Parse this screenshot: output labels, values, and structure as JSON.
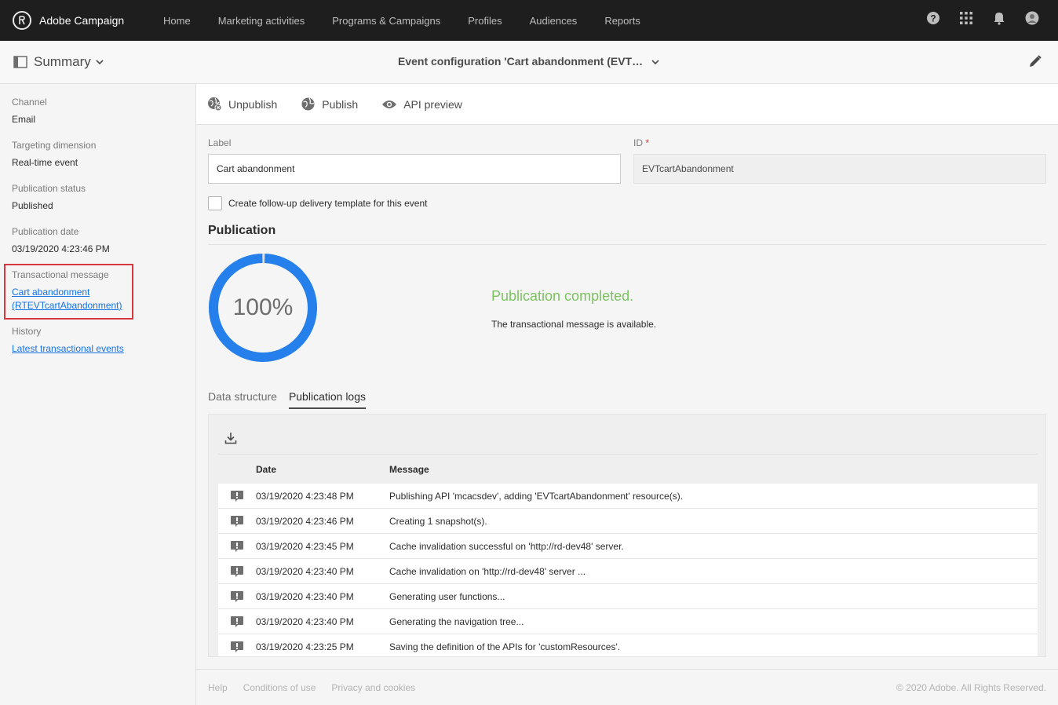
{
  "app": {
    "name": "Adobe Campaign",
    "nav": [
      "Home",
      "Marketing activities",
      "Programs & Campaigns",
      "Profiles",
      "Audiences",
      "Reports"
    ]
  },
  "header": {
    "summary_label": "Summary",
    "title": "Event configuration 'Cart abandonment (EVT…"
  },
  "sidebar": {
    "channel_label": "Channel",
    "channel_value": "Email",
    "targeting_label": "Targeting dimension",
    "targeting_value": "Real-time event",
    "status_label": "Publication status",
    "status_value": "Published",
    "date_label": "Publication date",
    "date_value": "03/19/2020 4:23:46 PM",
    "tm_label": "Transactional message",
    "tm_link_line1": "Cart abandonment",
    "tm_link_line2": "(RTEVTcartAbandonment)",
    "history_label": "History",
    "history_link": "Latest transactional events"
  },
  "toolbar": {
    "unpublish": "Unpublish",
    "publish": "Publish",
    "api_preview": "API preview"
  },
  "form": {
    "label_title": "Label",
    "label_value": "Cart abandonment",
    "id_title": "ID",
    "id_required": "*",
    "id_value": "EVTcartAbandonment",
    "checkbox_label": "Create follow-up delivery template for this event"
  },
  "publication": {
    "title": "Publication",
    "progress_text": "100%",
    "progress_value": 100,
    "status": "Publication completed.",
    "description": "The transactional message is available."
  },
  "tabs": [
    "Data structure",
    "Publication logs"
  ],
  "active_tab": "Publication logs",
  "logs": {
    "col_date": "Date",
    "col_message": "Message",
    "rows": [
      {
        "date": "03/19/2020 4:23:48 PM",
        "message": "Publishing API 'mcacsdev', adding 'EVTcartAbandonment' resource(s)."
      },
      {
        "date": "03/19/2020 4:23:46 PM",
        "message": "Creating 1 snapshot(s)."
      },
      {
        "date": "03/19/2020 4:23:45 PM",
        "message": "Cache invalidation successful on 'http://rd-dev48' server."
      },
      {
        "date": "03/19/2020 4:23:40 PM",
        "message": "Cache invalidation on 'http://rd-dev48' server ..."
      },
      {
        "date": "03/19/2020 4:23:40 PM",
        "message": "Generating user functions..."
      },
      {
        "date": "03/19/2020 4:23:40 PM",
        "message": "Generating the navigation tree..."
      },
      {
        "date": "03/19/2020 4:23:25 PM",
        "message": "Saving the definition of the APIs for 'customResources'."
      }
    ]
  },
  "footer": {
    "links": [
      "Help",
      "Conditions of use",
      "Privacy and cookies"
    ],
    "copyright": "© 2020 Adobe. All Rights Reserved."
  },
  "colors": {
    "topbar": "#1e1e1e",
    "accent": "#1473e6",
    "progress": "#2680eb",
    "success": "#7bc25f",
    "highlight": "#d7373f"
  }
}
